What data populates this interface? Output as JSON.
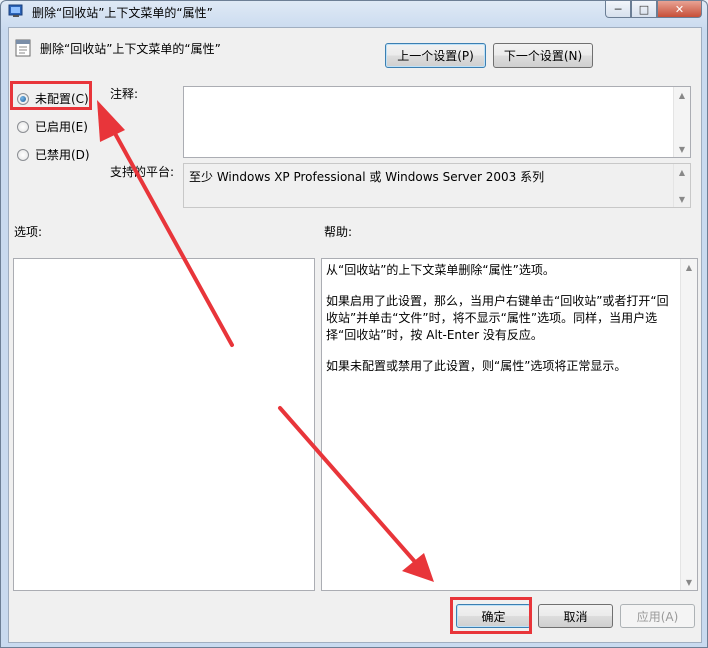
{
  "window": {
    "title": "删除“回收站”上下文菜单的“属性”",
    "minimize": "─",
    "maximize": "□",
    "close": "✕"
  },
  "header": {
    "title": "删除“回收站”上下文菜单的“属性”",
    "prev_button": "上一个设置(P)",
    "next_button": "下一个设置(N)"
  },
  "state": {
    "options": [
      {
        "label": "未配置(C)",
        "selected": true
      },
      {
        "label": "已启用(E)",
        "selected": false
      },
      {
        "label": "已禁用(D)",
        "selected": false
      }
    ]
  },
  "comment": {
    "label": "注释:",
    "value": ""
  },
  "supported": {
    "label": "支持的平台:",
    "value": "至少 Windows XP Professional 或 Windows Server 2003 系列"
  },
  "options_panel": {
    "label": "选项:"
  },
  "help": {
    "label": "帮助:",
    "paragraphs": [
      "从“回收站”的上下文菜单删除“属性”选项。",
      "如果启用了此设置，那么，当用户右键单击“回收站”或者打开“回收站”并单击“文件”时，将不显示“属性”选项。同样，当用户选择“回收站”时，按 Alt-Enter 没有反应。",
      "如果未配置或禁用了此设置，则“属性”选项将正常显示。"
    ]
  },
  "footer": {
    "ok": "确定",
    "cancel": "取消",
    "apply": "应用(A)"
  },
  "colors": {
    "annotation": "#e8353a",
    "focus": "#3c7fb1"
  }
}
